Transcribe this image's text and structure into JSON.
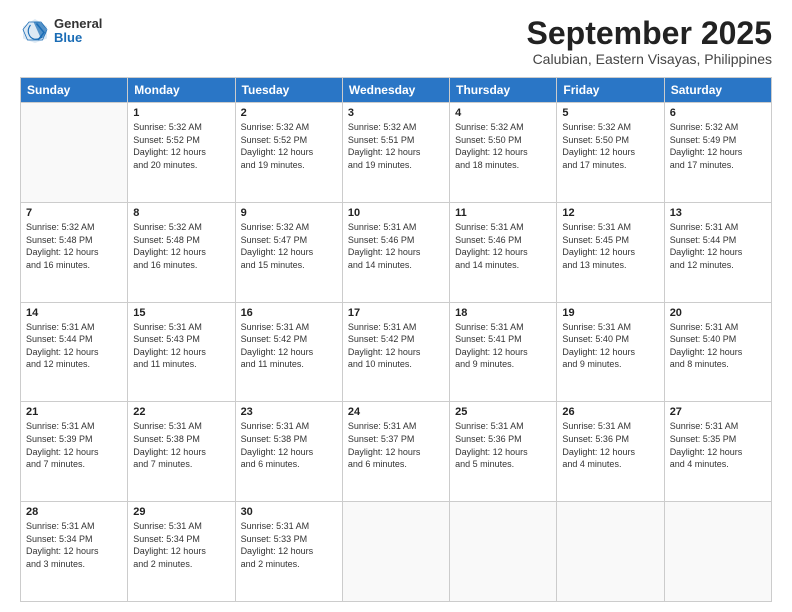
{
  "logo": {
    "general": "General",
    "blue": "Blue"
  },
  "title": "September 2025",
  "subtitle": "Calubian, Eastern Visayas, Philippines",
  "days_of_week": [
    "Sunday",
    "Monday",
    "Tuesday",
    "Wednesday",
    "Thursday",
    "Friday",
    "Saturday"
  ],
  "weeks": [
    [
      {
        "day": "",
        "info": ""
      },
      {
        "day": "1",
        "info": "Sunrise: 5:32 AM\nSunset: 5:52 PM\nDaylight: 12 hours\nand 20 minutes."
      },
      {
        "day": "2",
        "info": "Sunrise: 5:32 AM\nSunset: 5:52 PM\nDaylight: 12 hours\nand 19 minutes."
      },
      {
        "day": "3",
        "info": "Sunrise: 5:32 AM\nSunset: 5:51 PM\nDaylight: 12 hours\nand 19 minutes."
      },
      {
        "day": "4",
        "info": "Sunrise: 5:32 AM\nSunset: 5:50 PM\nDaylight: 12 hours\nand 18 minutes."
      },
      {
        "day": "5",
        "info": "Sunrise: 5:32 AM\nSunset: 5:50 PM\nDaylight: 12 hours\nand 17 minutes."
      },
      {
        "day": "6",
        "info": "Sunrise: 5:32 AM\nSunset: 5:49 PM\nDaylight: 12 hours\nand 17 minutes."
      }
    ],
    [
      {
        "day": "7",
        "info": "Sunrise: 5:32 AM\nSunset: 5:48 PM\nDaylight: 12 hours\nand 16 minutes."
      },
      {
        "day": "8",
        "info": "Sunrise: 5:32 AM\nSunset: 5:48 PM\nDaylight: 12 hours\nand 16 minutes."
      },
      {
        "day": "9",
        "info": "Sunrise: 5:32 AM\nSunset: 5:47 PM\nDaylight: 12 hours\nand 15 minutes."
      },
      {
        "day": "10",
        "info": "Sunrise: 5:31 AM\nSunset: 5:46 PM\nDaylight: 12 hours\nand 14 minutes."
      },
      {
        "day": "11",
        "info": "Sunrise: 5:31 AM\nSunset: 5:46 PM\nDaylight: 12 hours\nand 14 minutes."
      },
      {
        "day": "12",
        "info": "Sunrise: 5:31 AM\nSunset: 5:45 PM\nDaylight: 12 hours\nand 13 minutes."
      },
      {
        "day": "13",
        "info": "Sunrise: 5:31 AM\nSunset: 5:44 PM\nDaylight: 12 hours\nand 12 minutes."
      }
    ],
    [
      {
        "day": "14",
        "info": "Sunrise: 5:31 AM\nSunset: 5:44 PM\nDaylight: 12 hours\nand 12 minutes."
      },
      {
        "day": "15",
        "info": "Sunrise: 5:31 AM\nSunset: 5:43 PM\nDaylight: 12 hours\nand 11 minutes."
      },
      {
        "day": "16",
        "info": "Sunrise: 5:31 AM\nSunset: 5:42 PM\nDaylight: 12 hours\nand 11 minutes."
      },
      {
        "day": "17",
        "info": "Sunrise: 5:31 AM\nSunset: 5:42 PM\nDaylight: 12 hours\nand 10 minutes."
      },
      {
        "day": "18",
        "info": "Sunrise: 5:31 AM\nSunset: 5:41 PM\nDaylight: 12 hours\nand 9 minutes."
      },
      {
        "day": "19",
        "info": "Sunrise: 5:31 AM\nSunset: 5:40 PM\nDaylight: 12 hours\nand 9 minutes."
      },
      {
        "day": "20",
        "info": "Sunrise: 5:31 AM\nSunset: 5:40 PM\nDaylight: 12 hours\nand 8 minutes."
      }
    ],
    [
      {
        "day": "21",
        "info": "Sunrise: 5:31 AM\nSunset: 5:39 PM\nDaylight: 12 hours\nand 7 minutes."
      },
      {
        "day": "22",
        "info": "Sunrise: 5:31 AM\nSunset: 5:38 PM\nDaylight: 12 hours\nand 7 minutes."
      },
      {
        "day": "23",
        "info": "Sunrise: 5:31 AM\nSunset: 5:38 PM\nDaylight: 12 hours\nand 6 minutes."
      },
      {
        "day": "24",
        "info": "Sunrise: 5:31 AM\nSunset: 5:37 PM\nDaylight: 12 hours\nand 6 minutes."
      },
      {
        "day": "25",
        "info": "Sunrise: 5:31 AM\nSunset: 5:36 PM\nDaylight: 12 hours\nand 5 minutes."
      },
      {
        "day": "26",
        "info": "Sunrise: 5:31 AM\nSunset: 5:36 PM\nDaylight: 12 hours\nand 4 minutes."
      },
      {
        "day": "27",
        "info": "Sunrise: 5:31 AM\nSunset: 5:35 PM\nDaylight: 12 hours\nand 4 minutes."
      }
    ],
    [
      {
        "day": "28",
        "info": "Sunrise: 5:31 AM\nSunset: 5:34 PM\nDaylight: 12 hours\nand 3 minutes."
      },
      {
        "day": "29",
        "info": "Sunrise: 5:31 AM\nSunset: 5:34 PM\nDaylight: 12 hours\nand 2 minutes."
      },
      {
        "day": "30",
        "info": "Sunrise: 5:31 AM\nSunset: 5:33 PM\nDaylight: 12 hours\nand 2 minutes."
      },
      {
        "day": "",
        "info": ""
      },
      {
        "day": "",
        "info": ""
      },
      {
        "day": "",
        "info": ""
      },
      {
        "day": "",
        "info": ""
      }
    ]
  ]
}
